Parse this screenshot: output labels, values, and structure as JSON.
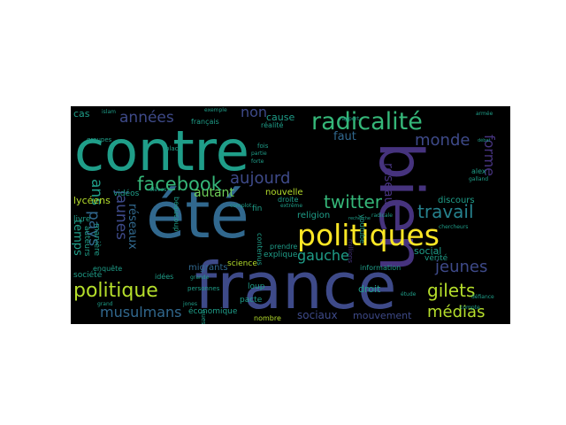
{
  "palette": {
    "purple": "#46337e",
    "indigo": "#3e4a89",
    "blue": "#31688e",
    "teal": "#26828e",
    "green": "#1f9e89",
    "lightgreen": "#35b779",
    "lime": "#6ece58",
    "yellow": "#fde725",
    "yellowgreen": "#b5de2b"
  },
  "words": [
    {
      "text": "contre",
      "color": "green"
    },
    {
      "text": "bien",
      "color": "purple"
    },
    {
      "text": "été",
      "color": "blue"
    },
    {
      "text": "france",
      "color": "indigo"
    },
    {
      "text": "politiques",
      "color": "yellow"
    },
    {
      "text": "radicalité",
      "color": "lightgreen"
    },
    {
      "text": "politique",
      "color": "yellowgreen"
    },
    {
      "text": "facebook",
      "color": "lightgreen"
    },
    {
      "text": "années",
      "color": "indigo"
    },
    {
      "text": "non",
      "color": "indigo"
    },
    {
      "text": "monde",
      "color": "indigo"
    },
    {
      "text": "forme",
      "color": "purple"
    },
    {
      "text": "aujourd",
      "color": "indigo"
    },
    {
      "text": "twitter",
      "color": "lightgreen"
    },
    {
      "text": "travail",
      "color": "teal"
    },
    {
      "text": "jeunes",
      "color": "indigo"
    },
    {
      "text": "gilets",
      "color": "yellowgreen"
    },
    {
      "text": "médias",
      "color": "yellowgreen"
    },
    {
      "text": "musulmans",
      "color": "blue"
    },
    {
      "text": "gauche",
      "color": "green"
    },
    {
      "text": "jaunes",
      "color": "indigo"
    },
    {
      "text": "pays",
      "color": "blue"
    },
    {
      "text": "ans",
      "color": "green"
    },
    {
      "text": "réseaux",
      "color": "blue"
    },
    {
      "text": "réseau",
      "color": "purple"
    },
    {
      "text": "temps",
      "color": "green"
    },
    {
      "text": "autant",
      "color": "lime"
    },
    {
      "text": "faut",
      "color": "blue"
    },
    {
      "text": "cause",
      "color": "green"
    },
    {
      "text": "cas",
      "color": "green"
    },
    {
      "text": "social",
      "color": "green"
    },
    {
      "text": "sociaux",
      "color": "indigo"
    },
    {
      "text": "mouvement",
      "color": "indigo"
    },
    {
      "text": "droit",
      "color": "green"
    },
    {
      "text": "lycéens",
      "color": "yellowgreen"
    },
    {
      "text": "auteurs",
      "color": "green"
    },
    {
      "text": "livre",
      "color": "green"
    },
    {
      "text": "vidéos",
      "color": "green"
    },
    {
      "text": "nouvelle",
      "color": "yellowgreen"
    },
    {
      "text": "religion",
      "color": "green"
    },
    {
      "text": "discours",
      "color": "green"
    },
    {
      "text": "migrants",
      "color": "blue"
    },
    {
      "text": "science",
      "color": "yellowgreen"
    },
    {
      "text": "explique",
      "color": "green"
    },
    {
      "text": "économique",
      "color": "green"
    },
    {
      "text": "nombre",
      "color": "yellowgreen"
    },
    {
      "text": "pacte",
      "color": "green"
    },
    {
      "text": "loup",
      "color": "green"
    },
    {
      "text": "manière",
      "color": "green"
    },
    {
      "text": "société",
      "color": "green"
    },
    {
      "text": "enquête",
      "color": "green"
    },
    {
      "text": "idées",
      "color": "green"
    },
    {
      "text": "utilisateurs",
      "color": "green"
    },
    {
      "text": "fin",
      "color": "green"
    },
    {
      "text": "droite",
      "color": "green"
    },
    {
      "text": "contenus",
      "color": "green"
    },
    {
      "text": "prendre",
      "color": "green"
    },
    {
      "text": "personnes",
      "color": "green"
    },
    {
      "text": "information",
      "color": "green"
    },
    {
      "text": "vérité",
      "color": "green"
    },
    {
      "text": "millions",
      "color": "purple"
    },
    {
      "text": "youtube",
      "color": "green"
    },
    {
      "text": "beaucoup",
      "color": "green"
    },
    {
      "text": "français",
      "color": "green"
    },
    {
      "text": "réalité",
      "color": "green"
    },
    {
      "text": "alex",
      "color": "green"
    },
    {
      "text": "étude",
      "color": "green"
    },
    {
      "text": "groupes",
      "color": "green"
    },
    {
      "text": "radicale",
      "color": "green"
    },
    {
      "text": "extrême",
      "color": "green"
    },
    {
      "text": "complot",
      "color": "green"
    },
    {
      "text": "recherche",
      "color": "green"
    },
    {
      "text": "défiance",
      "color": "green"
    },
    {
      "text": "grande",
      "color": "green"
    },
    {
      "text": "question",
      "color": "green"
    },
    {
      "text": "jones",
      "color": "green"
    },
    {
      "text": "rapport",
      "color": "green"
    },
    {
      "text": "galland",
      "color": "green"
    },
    {
      "text": "élèves",
      "color": "green"
    },
    {
      "text": "exemple",
      "color": "green"
    },
    {
      "text": "place",
      "color": "green"
    },
    {
      "text": "fois",
      "color": "green"
    },
    {
      "text": "partie",
      "color": "green"
    },
    {
      "text": "forte",
      "color": "green"
    },
    {
      "text": "compte",
      "color": "green"
    },
    {
      "text": "chercheurs",
      "color": "green"
    },
    {
      "text": "débat",
      "color": "green"
    },
    {
      "text": "armée",
      "color": "green"
    },
    {
      "text": "islam",
      "color": "green"
    },
    {
      "text": "grand",
      "color": "green"
    }
  ]
}
